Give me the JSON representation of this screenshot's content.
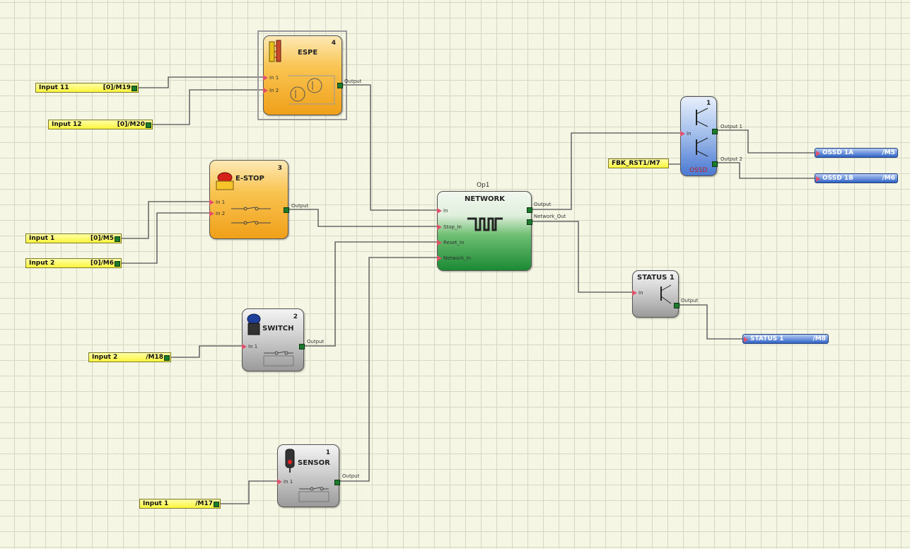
{
  "inputs": [
    {
      "id": "in11",
      "label": "Input 11",
      "code": "[0]/M19"
    },
    {
      "id": "in12",
      "label": "Input 12",
      "code": "[0]/M20"
    },
    {
      "id": "in1a",
      "label": "Input 1",
      "code": "[0]/M5"
    },
    {
      "id": "in2a",
      "label": "Input 2",
      "code": "[0]/M6"
    },
    {
      "id": "in2b",
      "label": "Input 2",
      "code": "/M18"
    },
    {
      "id": "in1b",
      "label": "Input 1",
      "code": "/M17"
    },
    {
      "id": "fbk",
      "label": "FBK_RST1/M7",
      "code": ""
    }
  ],
  "blocks": {
    "espe": {
      "title": "ESPE",
      "number": "4",
      "in1": "In 1",
      "in2": "In 2",
      "output": "Output"
    },
    "estop": {
      "title": "E-STOP",
      "number": "3",
      "in1": "In 1",
      "in2": "In 2",
      "output": "Output"
    },
    "switch": {
      "title": "SWITCH",
      "number": "2",
      "in1": "In 1",
      "output": "Output"
    },
    "sensor": {
      "title": "SENSOR",
      "number": "1",
      "in1": "In 1",
      "output": "Output"
    },
    "network": {
      "op": "Op1",
      "title": "NETWORK",
      "in": "In",
      "stop_in": "Stop_In",
      "reset_in": "Reset_In",
      "network_in": "Network_In",
      "output": "Output",
      "network_out": "Network_Out"
    },
    "ossd": {
      "number": "1",
      "in": "In",
      "output1": "Output 1",
      "output2": "Output 2",
      "footer": "OSSD"
    },
    "status": {
      "title": "STATUS 1",
      "in": "In",
      "output": "Output"
    }
  },
  "outputs": [
    {
      "id": "ossd1a",
      "label": "OSSD 1A",
      "code": "/M5"
    },
    {
      "id": "ossd1b",
      "label": "OSSD 1B",
      "code": "/M6"
    },
    {
      "id": "status1",
      "label": "STATUS 1",
      "code": "/M8"
    }
  ],
  "icons": [
    "light-curtain-icon",
    "transistor-icon",
    "emergency-stop-icon",
    "push-button-icon",
    "photo-sensor-icon",
    "pulse-train-icon"
  ]
}
